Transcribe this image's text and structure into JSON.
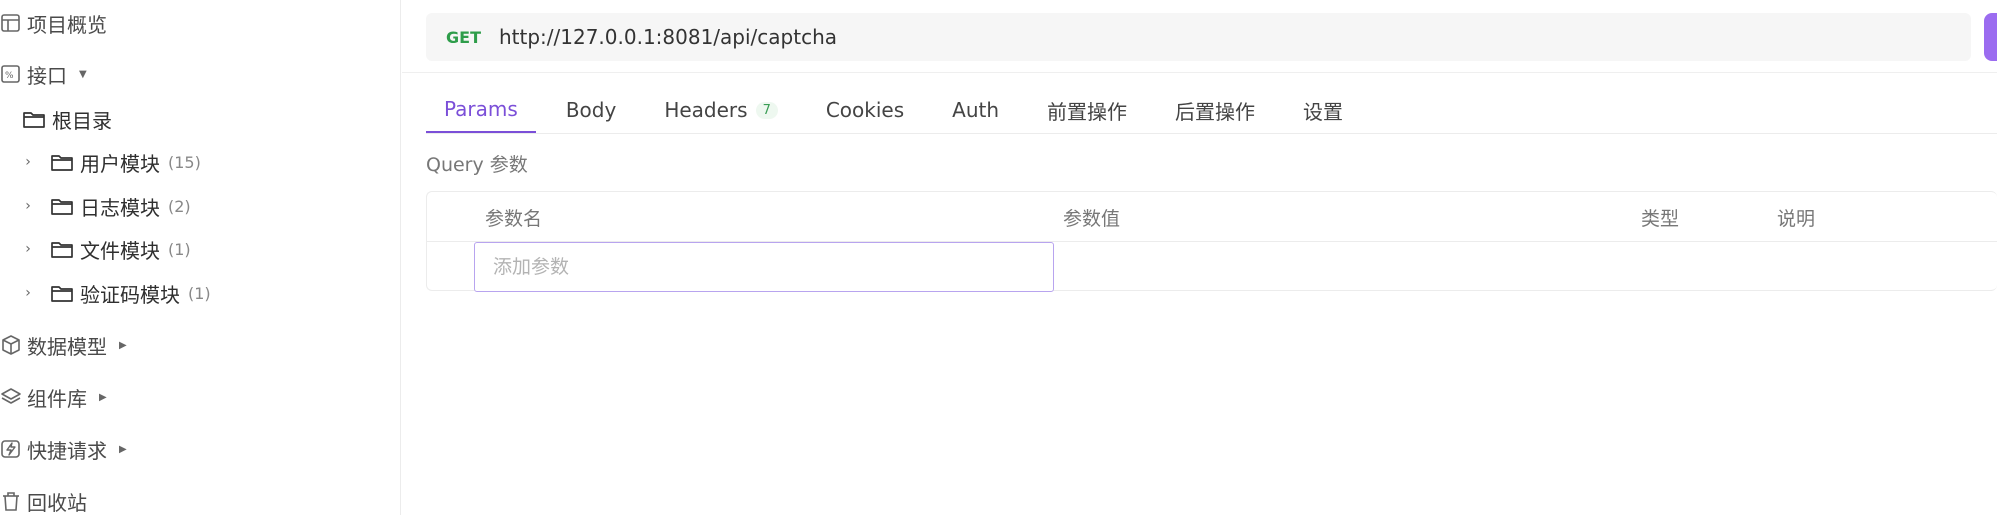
{
  "sidebar": {
    "nav": [
      {
        "label": "项目概览",
        "icon": "layout-icon"
      },
      {
        "label": "接口",
        "icon": "api-icon"
      },
      {
        "label": "数据模型",
        "icon": "cube-icon"
      },
      {
        "label": "组件库",
        "icon": "layers-icon"
      },
      {
        "label": "快捷请求",
        "icon": "lightning-icon"
      },
      {
        "label": "回收站",
        "icon": "trash-icon"
      }
    ],
    "root": {
      "label": "根目录"
    },
    "folders": [
      {
        "label": "用户模块",
        "count": "(15)"
      },
      {
        "label": "日志模块",
        "count": "(2)"
      },
      {
        "label": "文件模块",
        "count": "(1)"
      },
      {
        "label": "验证码模块",
        "count": "(1)"
      }
    ]
  },
  "request": {
    "method": "GET",
    "url": "http://127.0.0.1:8081/api/captcha"
  },
  "tabs": [
    {
      "label": "Params",
      "active": true
    },
    {
      "label": "Body"
    },
    {
      "label": "Headers",
      "badge": "7"
    },
    {
      "label": "Cookies"
    },
    {
      "label": "Auth"
    },
    {
      "label": "前置操作"
    },
    {
      "label": "后置操作"
    },
    {
      "label": "设置"
    }
  ],
  "params": {
    "section_title": "Query 参数",
    "columns": [
      "参数名",
      "参数值",
      "类型",
      "说明"
    ],
    "input_placeholder": "添加参数"
  },
  "colors": {
    "accent": "#7b4fd8",
    "method": "#2e9d4a"
  }
}
